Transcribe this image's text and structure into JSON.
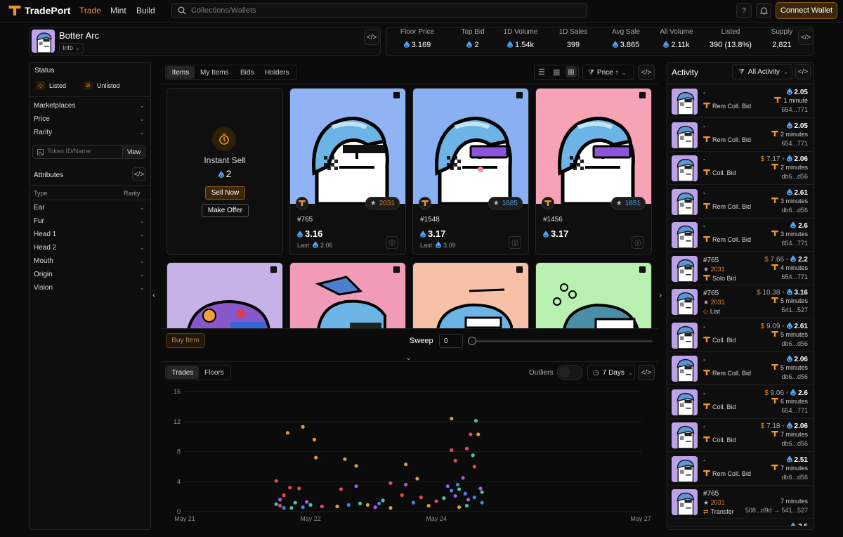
{
  "nav": {
    "brand": "TradePort",
    "links": [
      "Trade",
      "Mint",
      "Build"
    ],
    "search_placeholder": "Collections/Wallets",
    "help": "?",
    "connect": "Connect Wallet"
  },
  "collection": {
    "name": "Botter Arc",
    "info": "Info"
  },
  "stats": [
    {
      "label": "Floor Price",
      "value": "3.169",
      "sui": true
    },
    {
      "label": "Top Bid",
      "value": "2",
      "sui": true
    },
    {
      "label": "1D Volume",
      "value": "1.54k",
      "sui": true
    },
    {
      "label": "1D Sales",
      "value": "399",
      "sui": false
    },
    {
      "label": "Avg Sale",
      "value": "3.865",
      "sui": true
    },
    {
      "label": "All Volume",
      "value": "2.11k",
      "sui": true
    },
    {
      "label": "Listed",
      "value": "390 (13.8%)",
      "sui": false
    },
    {
      "label": "Supply",
      "value": "2,821",
      "sui": false
    }
  ],
  "sidebar": {
    "status_title": "Status",
    "listed": "Listed",
    "unlisted": "Unlisted",
    "filters": [
      "Marketplaces",
      "Price",
      "Rarity"
    ],
    "token_placeholder": "Token ID/Name",
    "view": "View",
    "attributes_title": "Attributes",
    "col_type": "Type",
    "col_rarity": "Rarity",
    "attributes": [
      "Ear",
      "Fur",
      "Head 1",
      "Head 2",
      "Mouth",
      "Origin",
      "Vision"
    ]
  },
  "tabs": {
    "items": [
      "Items",
      "My Items",
      "Bids",
      "Holders"
    ],
    "sort": "Price ↑"
  },
  "instant_sell": {
    "title": "Instant Sell",
    "value": "2",
    "sell_now": "Sell Now",
    "make_offer": "Make Offer"
  },
  "cards": [
    {
      "name": "#765",
      "price": "3.16",
      "last_label": "Last:",
      "last": "2.06",
      "rank": "2031",
      "rank_color": "#e0832c",
      "bg": "#8fb3f5"
    },
    {
      "name": "#1548",
      "price": "3.17",
      "last_label": "Last:",
      "last": "3.09",
      "rank": "1685",
      "rank_color": "#4fa3e8",
      "bg": "#89b0f2"
    },
    {
      "name": "#1456",
      "price": "3.17",
      "last_label": "",
      "last": "",
      "rank": "1851",
      "rank_color": "#4fa3e8",
      "bg": "#f5a3b5"
    }
  ],
  "row2_colors": [
    "#c6b1e8",
    "#f29bb8",
    "#f6c1a6",
    "#b8f0b2"
  ],
  "bottom_bar": {
    "buy": "Buy Item",
    "sweep": "Sweep",
    "sweep_value": "0"
  },
  "chart_tabs": {
    "trades": "Trades",
    "floors": "Floors",
    "outliers": "Outliers",
    "range": "7 Days"
  },
  "chart_data": {
    "type": "scatter",
    "title": "",
    "xlabel": "",
    "ylabel": "",
    "x_ticks": [
      "May 21",
      "May 22",
      "May 24",
      "May 27"
    ],
    "y_ticks": [
      0,
      4,
      8,
      12,
      16
    ],
    "ylim": [
      0,
      16
    ],
    "xlim": [
      0,
      6
    ],
    "grid": true,
    "series": [
      {
        "color": "#e4993a",
        "points": [
          [
            1.35,
            10.5
          ],
          [
            1.55,
            11.3
          ],
          [
            1.7,
            9.6
          ],
          [
            1.72,
            7.2
          ],
          [
            2.1,
            7.0
          ],
          [
            2.25,
            6.1
          ],
          [
            2.9,
            6.3
          ],
          [
            3.05,
            4.4
          ],
          [
            3.5,
            12.4
          ],
          [
            3.85,
            10.3
          ],
          [
            2.0,
            0.7
          ],
          [
            2.4,
            0.9
          ],
          [
            2.7,
            0.5
          ],
          [
            3.2,
            0.8
          ],
          [
            3.6,
            0.6
          ]
        ]
      },
      {
        "color": "#e34a5a",
        "points": [
          [
            1.2,
            4.1
          ],
          [
            1.3,
            2.2
          ],
          [
            1.38,
            3.2
          ],
          [
            1.5,
            3.1
          ],
          [
            2.05,
            3.0
          ],
          [
            2.7,
            3.8
          ],
          [
            2.85,
            2.2
          ],
          [
            3.5,
            8.2
          ],
          [
            3.55,
            6.8
          ],
          [
            3.7,
            8.4
          ],
          [
            3.75,
            10.3
          ],
          [
            3.8,
            6.0
          ],
          [
            3.1,
            1.9
          ],
          [
            3.3,
            1.4
          ],
          [
            1.25,
            0.8
          ],
          [
            1.8,
            0.7
          ]
        ]
      },
      {
        "color": "#4bc6a4",
        "points": [
          [
            1.2,
            1.0
          ],
          [
            1.45,
            1.2
          ],
          [
            1.65,
            0.9
          ],
          [
            2.3,
            1.1
          ],
          [
            2.6,
            1.5
          ],
          [
            3.4,
            1.8
          ],
          [
            3.6,
            3.0
          ],
          [
            3.82,
            12.1
          ],
          [
            3.78,
            7.5
          ],
          [
            3.9,
            2.6
          ],
          [
            3.7,
            0.8
          ],
          [
            1.4,
            0.5
          ]
        ]
      },
      {
        "color": "#a55de0",
        "points": [
          [
            1.25,
            1.6
          ],
          [
            1.6,
            1.3
          ],
          [
            2.25,
            3.4
          ],
          [
            2.9,
            3.6
          ],
          [
            3.45,
            3.4
          ],
          [
            3.55,
            2.1
          ],
          [
            3.65,
            4.5
          ],
          [
            3.72,
            1.6
          ],
          [
            3.88,
            3.1
          ],
          [
            2.5,
            0.6
          ]
        ]
      },
      {
        "color": "#4f7ee6",
        "points": [
          [
            1.3,
            0.5
          ],
          [
            1.55,
            0.6
          ],
          [
            2.55,
            1.1
          ],
          [
            3.0,
            1.2
          ],
          [
            3.5,
            2.8
          ],
          [
            3.58,
            3.6
          ],
          [
            3.68,
            2.4
          ],
          [
            3.8,
            1.9
          ],
          [
            3.9,
            1.2
          ],
          [
            2.15,
            0.9
          ]
        ]
      }
    ]
  },
  "activity": {
    "title": "Activity",
    "filter": "All Activity",
    "rows": [
      {
        "title": "-",
        "type": "Rem Coll. Bid",
        "price": "2.05",
        "usd": "",
        "time": "1 minute",
        "addr": "654...771",
        "star": ""
      },
      {
        "title": "-",
        "type": "Rem Coll. Bid",
        "price": "2.05",
        "usd": "",
        "time": "2 minutes",
        "addr": "654...771",
        "star": ""
      },
      {
        "title": "-",
        "type": "Coll. Bid",
        "price": "2.06",
        "usd": "7.17",
        "time": "2 minutes",
        "addr": "db6...d56",
        "star": ""
      },
      {
        "title": "-",
        "type": "Rem Coll. Bid",
        "price": "2.61",
        "usd": "",
        "time": "3 minutes",
        "addr": "db6...d56",
        "star": ""
      },
      {
        "title": "-",
        "type": "Rem Coll. Bid",
        "price": "2.6",
        "usd": "",
        "time": "3 minutes",
        "addr": "654...771",
        "star": ""
      },
      {
        "title": "#765",
        "type": "Solo Bid",
        "price": "2.2",
        "usd": "7.66",
        "time": "4 minutes",
        "addr": "654...771",
        "star": "2031"
      },
      {
        "title": "#765",
        "type": "List",
        "price": "3.16",
        "usd": "10.38",
        "time": "5 minutes",
        "addr": "541...527",
        "star": "2031"
      },
      {
        "title": "-",
        "type": "Coll. Bid",
        "price": "2.61",
        "usd": "9.09",
        "time": "5 minutes",
        "addr": "db6...d56",
        "star": ""
      },
      {
        "title": "-",
        "type": "Rem Coll. Bid",
        "price": "2.06",
        "usd": "",
        "time": "5 minutes",
        "addr": "db6...d56",
        "star": ""
      },
      {
        "title": "-",
        "type": "Coll. Bid",
        "price": "2.6",
        "usd": "9.06",
        "time": "6 minutes",
        "addr": "654...771",
        "star": ""
      },
      {
        "title": "-",
        "type": "Coll. Bid",
        "price": "2.06",
        "usd": "7.18",
        "time": "7 minutes",
        "addr": "db6...d56",
        "star": ""
      },
      {
        "title": "-",
        "type": "Rem Coll. Bid",
        "price": "2.51",
        "usd": "",
        "time": "7 minutes",
        "addr": "db6...d56",
        "star": ""
      },
      {
        "title": "#765",
        "type": "Transfer",
        "price": "",
        "usd": "",
        "time": "7 minutes",
        "addr": "508...d9d → 541...527",
        "star": "2031"
      }
    ],
    "last_price": "2.5"
  }
}
